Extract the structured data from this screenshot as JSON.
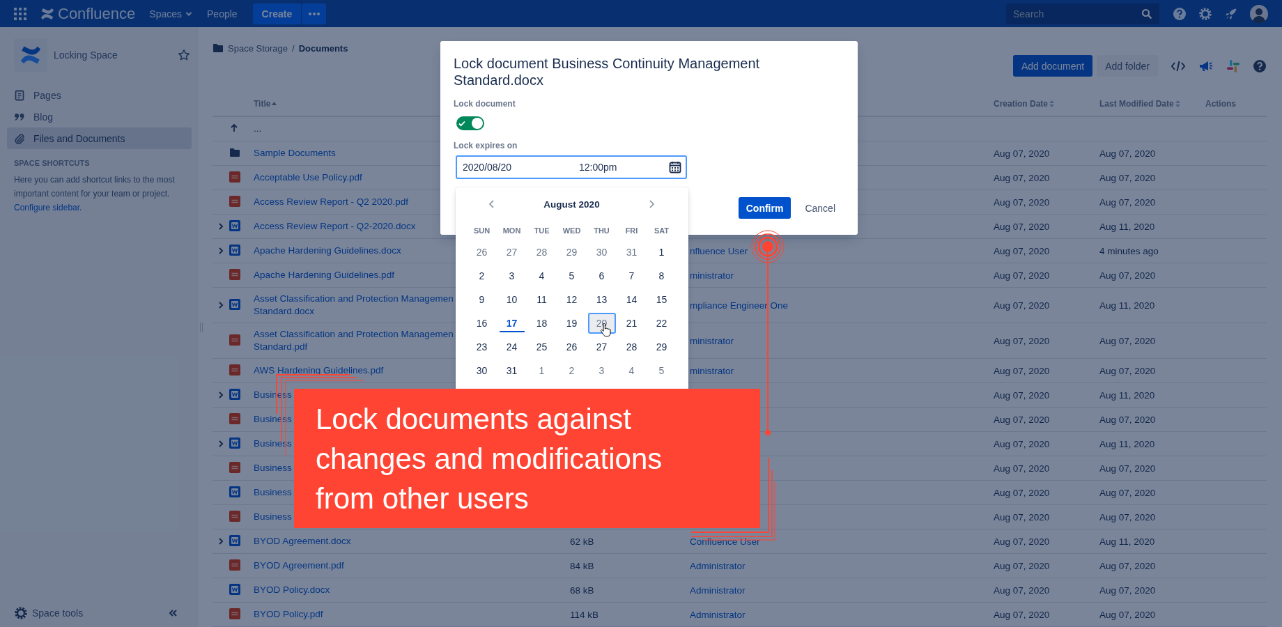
{
  "top_nav": {
    "product": "Confluence",
    "links": [
      {
        "label": "Spaces",
        "dropdown": true
      },
      {
        "label": "People",
        "dropdown": false
      }
    ],
    "create_button": "Create",
    "search": {
      "placeholder": "Search"
    }
  },
  "sidebar": {
    "space_name": "Locking Space",
    "items": [
      {
        "kind": "pages",
        "label": "Pages",
        "selected": false
      },
      {
        "kind": "blog",
        "label": "Blog",
        "selected": false
      },
      {
        "kind": "files",
        "label": "Files and Documents",
        "selected": true
      }
    ],
    "shortcuts_heading": "SPACE SHORTCUTS",
    "shortcuts_text": "Here you can add shortcut links to the most important content for your team or project.",
    "shortcuts_link": "Configure sidebar.",
    "footer_label": "Space tools"
  },
  "breadcrumb": {
    "separator": "/",
    "items": [
      {
        "label": "Space Storage",
        "current": false
      },
      {
        "label": "Documents",
        "current": true
      }
    ]
  },
  "toolbar": {
    "buttons": [
      {
        "label": "Add document",
        "primary": true
      },
      {
        "label": "Add folder",
        "primary": false
      }
    ]
  },
  "table": {
    "columns": [
      {
        "label": "Title",
        "sortable": true,
        "sorted": true
      },
      {
        "label": "Creation Date",
        "sortable": true,
        "sorted": false
      },
      {
        "label": "Last Modified Date",
        "sortable": true,
        "sorted": false
      },
      {
        "label": "Actions",
        "sortable": false,
        "sorted": false
      }
    ],
    "rows": [
      {
        "kind": "parent",
        "expandable": false,
        "title": "..."
      },
      {
        "kind": "folder",
        "expandable": false,
        "title": "Sample Documents",
        "created": "Aug 07, 2020",
        "modified": "Aug 07, 2020"
      },
      {
        "kind": "pdf",
        "expandable": false,
        "title": "Acceptable Use Policy.pdf",
        "created": "Aug 07, 2020",
        "modified": "Aug 07, 2020"
      },
      {
        "kind": "pdf",
        "expandable": false,
        "title": "Access Review Report - Q2 2020.pdf",
        "created": "Aug 07, 2020",
        "modified": "Aug 07, 2020"
      },
      {
        "kind": "word",
        "expandable": true,
        "title": "Access Review Report - Q2-2020.docx",
        "created": "Aug 07, 2020",
        "modified": "Aug 11, 2020"
      },
      {
        "kind": "word",
        "expandable": true,
        "title": "Apache Hardening Guidelines.docx",
        "creator": "nfluence User",
        "created": "Aug 07, 2020",
        "modified": "4 minutes ago"
      },
      {
        "kind": "pdf",
        "expandable": false,
        "title": "Apache Hardening Guidelines.pdf",
        "creator": "ministrator",
        "created": "Aug 07, 2020",
        "modified": "Aug 07, 2020"
      },
      {
        "kind": "word",
        "expandable": true,
        "title": "Asset Classification and Protection Managemen\nStandard.docx",
        "creator": "mpliance Engineer One",
        "created": "Aug 07, 2020",
        "modified": "Aug 11, 2020"
      },
      {
        "kind": "pdf",
        "expandable": false,
        "title": "Asset Classification and Protection Managemen\nStandard.pdf",
        "creator": "ministrator",
        "created": "Aug 07, 2020",
        "modified": "Aug 07, 2020"
      },
      {
        "kind": "pdf",
        "expandable": false,
        "title": "AWS Hardening Guidelines.pdf",
        "creator": "ministrator",
        "created": "Aug 07, 2020",
        "modified": "Aug 07, 2020"
      },
      {
        "kind": "word",
        "expandable": true,
        "title": "Business",
        "created": "Aug 07, 2020",
        "modified": "Aug 11, 2020"
      },
      {
        "kind": "pdf",
        "expandable": false,
        "title": "Business",
        "created": "Aug 07, 2020",
        "modified": "Aug 07, 2020"
      },
      {
        "kind": "word",
        "expandable": true,
        "title": "Business",
        "created": "Aug 07, 2020",
        "modified": "Aug 11, 2020"
      },
      {
        "kind": "pdf",
        "expandable": false,
        "title": "Business",
        "created": "Aug 07, 2020",
        "modified": "Aug 07, 2020"
      },
      {
        "kind": "word",
        "expandable": false,
        "title": "Business",
        "created": "Aug 07, 2020",
        "modified": "Aug 07, 2020"
      },
      {
        "kind": "pdf",
        "expandable": false,
        "title": "Business",
        "created": "Aug 07, 2020",
        "modified": "Aug 07, 2020"
      },
      {
        "kind": "word",
        "expandable": true,
        "title": "BYOD Agreement.docx",
        "size": "62 kB",
        "creator": "Confluence User",
        "created": "Aug 07, 2020",
        "modified": "Aug 11, 2020"
      },
      {
        "kind": "pdf",
        "expandable": false,
        "title": "BYOD Agreement.pdf",
        "size": "84 kB",
        "creator": "Administrator",
        "created": "Aug 07, 2020",
        "modified": "Aug 07, 2020"
      },
      {
        "kind": "word",
        "expandable": false,
        "title": "BYOD Policy.docx",
        "size": "68 kB",
        "creator": "Administrator",
        "created": "Aug 07, 2020",
        "modified": "Aug 07, 2020"
      },
      {
        "kind": "pdf",
        "expandable": false,
        "title": "BYOD Policy.pdf",
        "size": "114 kB",
        "creator": "Administrator",
        "created": "Aug 07, 2020",
        "modified": "Aug 07, 2020"
      }
    ]
  },
  "modal": {
    "title": "Lock document Business Continuity Management Standard.docx",
    "lock_toggle": {
      "label": "Lock document",
      "on": true
    },
    "expires_label": "Lock expires on",
    "date": "2020/08/20",
    "time": "12:00pm",
    "calendar": {
      "month": "August 2020",
      "weekdays": [
        "SUN",
        "MON",
        "TUE",
        "WED",
        "THU",
        "FRI",
        "SAT"
      ],
      "days": [
        {
          "label": "26",
          "other_month": true,
          "today": false,
          "selected": false
        },
        {
          "label": "27",
          "other_month": true,
          "today": false,
          "selected": false
        },
        {
          "label": "28",
          "other_month": true,
          "today": false,
          "selected": false
        },
        {
          "label": "29",
          "other_month": true,
          "today": false,
          "selected": false
        },
        {
          "label": "30",
          "other_month": true,
          "today": false,
          "selected": false
        },
        {
          "label": "31",
          "other_month": true,
          "today": false,
          "selected": false
        },
        {
          "label": "1",
          "other_month": false,
          "today": false,
          "selected": false
        },
        {
          "label": "2",
          "other_month": false,
          "today": false,
          "selected": false
        },
        {
          "label": "3",
          "other_month": false,
          "today": false,
          "selected": false
        },
        {
          "label": "4",
          "other_month": false,
          "today": false,
          "selected": false
        },
        {
          "label": "5",
          "other_month": false,
          "today": false,
          "selected": false
        },
        {
          "label": "6",
          "other_month": false,
          "today": false,
          "selected": false
        },
        {
          "label": "7",
          "other_month": false,
          "today": false,
          "selected": false
        },
        {
          "label": "8",
          "other_month": false,
          "today": false,
          "selected": false
        },
        {
          "label": "9",
          "other_month": false,
          "today": false,
          "selected": false
        },
        {
          "label": "10",
          "other_month": false,
          "today": false,
          "selected": false
        },
        {
          "label": "11",
          "other_month": false,
          "today": false,
          "selected": false
        },
        {
          "label": "12",
          "other_month": false,
          "today": false,
          "selected": false
        },
        {
          "label": "13",
          "other_month": false,
          "today": false,
          "selected": false
        },
        {
          "label": "14",
          "other_month": false,
          "today": false,
          "selected": false
        },
        {
          "label": "15",
          "other_month": false,
          "today": false,
          "selected": false
        },
        {
          "label": "16",
          "other_month": false,
          "today": false,
          "selected": false
        },
        {
          "label": "17",
          "other_month": false,
          "today": true,
          "selected": false
        },
        {
          "label": "18",
          "other_month": false,
          "today": false,
          "selected": false
        },
        {
          "label": "19",
          "other_month": false,
          "today": false,
          "selected": false
        },
        {
          "label": "20",
          "other_month": false,
          "today": false,
          "selected": true
        },
        {
          "label": "21",
          "other_month": false,
          "today": false,
          "selected": false
        },
        {
          "label": "22",
          "other_month": false,
          "today": false,
          "selected": false
        },
        {
          "label": "23",
          "other_month": false,
          "today": false,
          "selected": false
        },
        {
          "label": "24",
          "other_month": false,
          "today": false,
          "selected": false
        },
        {
          "label": "25",
          "other_month": false,
          "today": false,
          "selected": false
        },
        {
          "label": "26",
          "other_month": false,
          "today": false,
          "selected": false
        },
        {
          "label": "27",
          "other_month": false,
          "today": false,
          "selected": false
        },
        {
          "label": "28",
          "other_month": false,
          "today": false,
          "selected": false
        },
        {
          "label": "29",
          "other_month": false,
          "today": false,
          "selected": false
        },
        {
          "label": "30",
          "other_month": false,
          "today": false,
          "selected": false
        },
        {
          "label": "31",
          "other_month": false,
          "today": false,
          "selected": false
        },
        {
          "label": "1",
          "other_month": true,
          "today": false,
          "selected": false
        },
        {
          "label": "2",
          "other_month": true,
          "today": false,
          "selected": false
        },
        {
          "label": "3",
          "other_month": true,
          "today": false,
          "selected": false
        },
        {
          "label": "4",
          "other_month": true,
          "today": false,
          "selected": false
        },
        {
          "label": "5",
          "other_month": true,
          "today": false,
          "selected": false
        }
      ]
    },
    "confirm_button": "Confirm",
    "cancel_button": "Cancel"
  },
  "callout": {
    "text": "Lock documents against\nchanges and modifications\nfrom other users"
  }
}
